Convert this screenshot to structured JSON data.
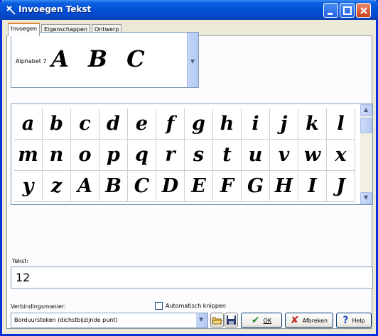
{
  "window": {
    "title": "Invoegen Tekst"
  },
  "tabs": [
    {
      "label": "Invoegen",
      "active": true
    },
    {
      "label": "Eigenschappen",
      "active": false
    },
    {
      "label": "Ontwerp",
      "active": false
    }
  ],
  "font_combo": {
    "name": "Alphabet 7",
    "preview": "A B C"
  },
  "glyphs": [
    "a",
    "b",
    "c",
    "d",
    "e",
    "f",
    "g",
    "h",
    "i",
    "j",
    "k",
    "l",
    "m",
    "n",
    "o",
    "p",
    "q",
    "r",
    "s",
    "t",
    "u",
    "v",
    "w",
    "x",
    "y",
    "z",
    "A",
    "B",
    "C",
    "D",
    "E",
    "F",
    "G",
    "H",
    "I",
    "J"
  ],
  "text_field": {
    "label": "Tekst:",
    "value": "12"
  },
  "connection": {
    "label": "Verbindingsmanier:",
    "value": "Borduursteken (dichstbijzijnde punt)"
  },
  "auto_trim": {
    "label": "Automatisch knippen",
    "checked": false
  },
  "buttons": {
    "ok": "OK",
    "cancel": "Afbreken",
    "help": "Help"
  },
  "colors": {
    "title_bar": "#0350d6",
    "ok_check": "#2e8b2e",
    "cancel_x": "#c0281e",
    "help_q": "#1f4fb8",
    "active_tab": "#e68b2c"
  }
}
